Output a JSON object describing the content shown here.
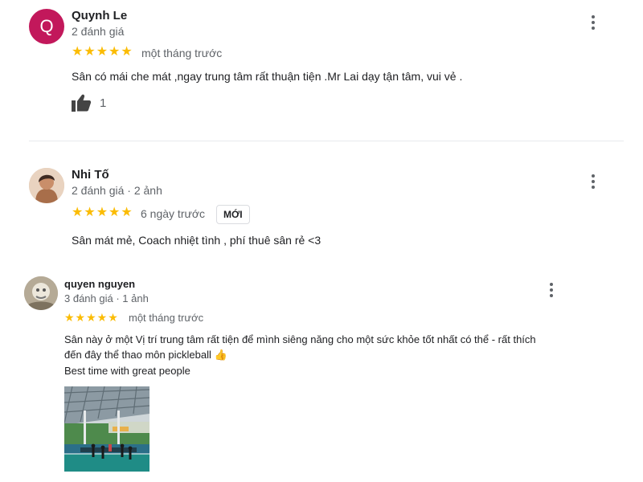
{
  "reviews": [
    {
      "author": "Quynh Le",
      "avatar_letter": "Q",
      "avatar_color": "#c2185b",
      "meta": "2 đánh giá",
      "stars": "★★★★★",
      "time": "một tháng trước",
      "text": "Sân có mái che mát ,ngay trung tâm rất thuận tiện .Mr Lai dạy tận tâm, vui vẻ .",
      "likes": "1"
    },
    {
      "author": "Nhi Tố",
      "meta": "2 đánh giá · 2 ảnh",
      "stars": "★★★★★",
      "time": "6 ngày trước",
      "badge": "MỚI",
      "text": "Sân mát mẻ, Coach nhiệt tình , phí thuê sân rẻ <3"
    },
    {
      "author": "quyen nguyen",
      "meta": "3 đánh giá · 1 ảnh",
      "stars": "★★★★★",
      "time": "một tháng trước",
      "text_line1": "Sân này ở một Vị trí trung tâm rất tiện để mình siêng năng cho một sức khỏe tốt nhất có thể - rất thích",
      "text_line2": "đến đây thể thao môn pickleball 👍",
      "text_line3": "Best time with  great people"
    }
  ],
  "colors": {
    "star": "#fbbc04",
    "text": "#202124",
    "secondary": "#5f6368"
  }
}
